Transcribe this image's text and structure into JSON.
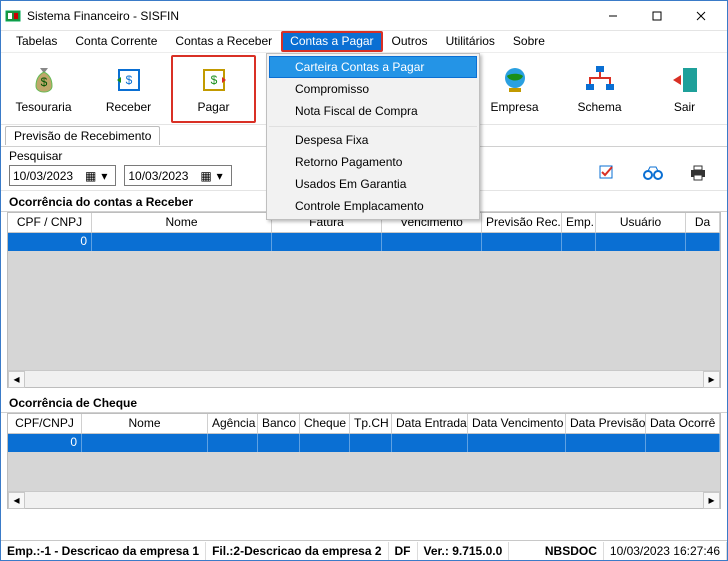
{
  "window": {
    "title": "Sistema Financeiro - SISFIN"
  },
  "menubar": {
    "items": [
      "Tabelas",
      "Conta Corrente",
      "Contas a Receber",
      "Contas a Pagar",
      "Outros",
      "Utilitários",
      "Sobre"
    ],
    "open_index": 3
  },
  "dropdown": {
    "items": [
      "Carteira Contas a Pagar",
      "Compromisso",
      "Nota Fiscal de Compra",
      "Despesa Fixa",
      "Retorno Pagamento",
      "Usados Em Garantia",
      "Controle Emplacamento"
    ],
    "highlight_index": 0
  },
  "toolbar": {
    "buttons": [
      "Tesouraria",
      "Receber",
      "Pagar",
      "",
      "",
      "",
      "Empresa",
      "Schema",
      "Sair"
    ]
  },
  "tab": {
    "label": "Previsão de Recebimento"
  },
  "search": {
    "label": "Pesquisar",
    "date_from": "10/03/2023",
    "date_to": "10/03/2023"
  },
  "section1": {
    "title": "Ocorrência do contas a Receber",
    "columns": [
      "CPF / CNPJ",
      "Nome",
      "Fatura",
      "Vencimento",
      "Previsão Rec.",
      "Emp.",
      "Usuário",
      "Da"
    ],
    "first_cell": "0"
  },
  "section2": {
    "title": "Ocorrência de Cheque",
    "columns": [
      "CPF/CNPJ",
      "Nome",
      "Agência",
      "Banco",
      "Cheque",
      "Tp.CH",
      "Data Entrada",
      "Data Vencimento",
      "Data Previsão",
      "Data Ocorrê"
    ],
    "first_cell": "0"
  },
  "status": {
    "emp": "Emp.:-1 - Descricao da empresa 1",
    "fil": "Fil.:2-Descricao da empresa 2",
    "uf": "DF",
    "ver": "Ver.: 9.715.0.0",
    "user": "NBSDOC",
    "datetime": "10/03/2023 16:27:46"
  }
}
